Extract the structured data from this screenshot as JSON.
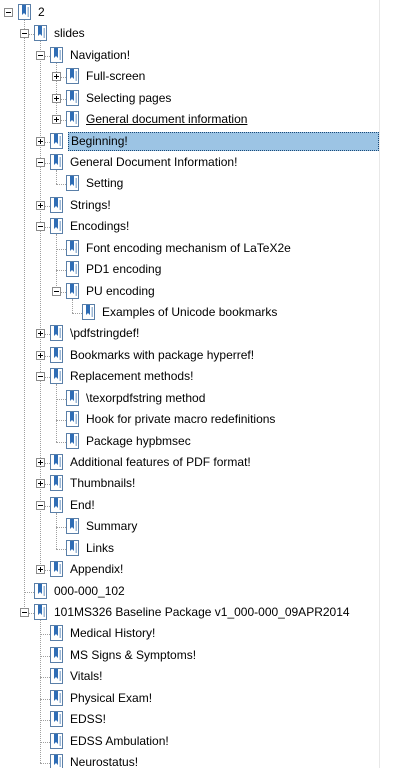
{
  "tree": {
    "items": [
      {
        "label": "2",
        "level": 0,
        "toggle": "minus"
      },
      {
        "label": "slides",
        "level": 1,
        "toggle": "minus"
      },
      {
        "label": "Navigation!",
        "level": 2,
        "toggle": "minus"
      },
      {
        "label": "Full-screen",
        "level": 3,
        "toggle": "plus"
      },
      {
        "label": "Selecting pages",
        "level": 3,
        "toggle": "plus"
      },
      {
        "label": "General document information",
        "level": 3,
        "toggle": "plus",
        "underline": true
      },
      {
        "label": "Beginning!",
        "level": 2,
        "toggle": "plus",
        "selected": true
      },
      {
        "label": "General Document Information!",
        "level": 2,
        "toggle": "minus"
      },
      {
        "label": "Setting",
        "level": 3,
        "toggle": null
      },
      {
        "label": "Strings!",
        "level": 2,
        "toggle": "plus"
      },
      {
        "label": "Encodings!",
        "level": 2,
        "toggle": "minus"
      },
      {
        "label": "Font encoding mechanism of LaTeX2e",
        "level": 3,
        "toggle": null
      },
      {
        "label": "PD1 encoding",
        "level": 3,
        "toggle": null
      },
      {
        "label": "PU encoding",
        "level": 3,
        "toggle": "minus"
      },
      {
        "label": "Examples of Unicode bookmarks",
        "level": 4,
        "toggle": null
      },
      {
        "label": "\\pdfstringdef!",
        "level": 2,
        "toggle": "plus"
      },
      {
        "label": "Bookmarks with package hyperref!",
        "level": 2,
        "toggle": "plus"
      },
      {
        "label": "Replacement methods!",
        "level": 2,
        "toggle": "minus"
      },
      {
        "label": "\\texorpdfstring method",
        "level": 3,
        "toggle": null
      },
      {
        "label": "Hook for private macro redefinitions",
        "level": 3,
        "toggle": null
      },
      {
        "label": "Package hypbmsec",
        "level": 3,
        "toggle": null
      },
      {
        "label": "Additional features of PDF format!",
        "level": 2,
        "toggle": "plus"
      },
      {
        "label": "Thumbnails!",
        "level": 2,
        "toggle": "plus"
      },
      {
        "label": "End!",
        "level": 2,
        "toggle": "minus"
      },
      {
        "label": "Summary",
        "level": 3,
        "toggle": null
      },
      {
        "label": "Links",
        "level": 3,
        "toggle": null
      },
      {
        "label": "Appendix!",
        "level": 2,
        "toggle": "plus"
      },
      {
        "label": "000-000_102",
        "level": 1,
        "toggle": null
      },
      {
        "label": "101MS326 Baseline Package v1_000-000_09APR2014",
        "level": 1,
        "toggle": "minus"
      },
      {
        "label": "Medical History!",
        "level": 2,
        "toggle": null
      },
      {
        "label": "MS Signs & Symptoms!",
        "level": 2,
        "toggle": null
      },
      {
        "label": "Vitals!",
        "level": 2,
        "toggle": null
      },
      {
        "label": "Physical Exam!",
        "level": 2,
        "toggle": null
      },
      {
        "label": "EDSS!",
        "level": 2,
        "toggle": null
      },
      {
        "label": "EDSS Ambulation!",
        "level": 2,
        "toggle": null
      },
      {
        "label": "Neurostatus!",
        "level": 2,
        "toggle": null
      }
    ]
  },
  "colors": {
    "selection_bg": "#9cc4e4",
    "connector": "#a0a0a0",
    "icon_blue": "#2f6db5"
  },
  "icons": {
    "bookmark": "bookmark-icon",
    "expand": "plus-icon",
    "collapse": "minus-icon"
  }
}
